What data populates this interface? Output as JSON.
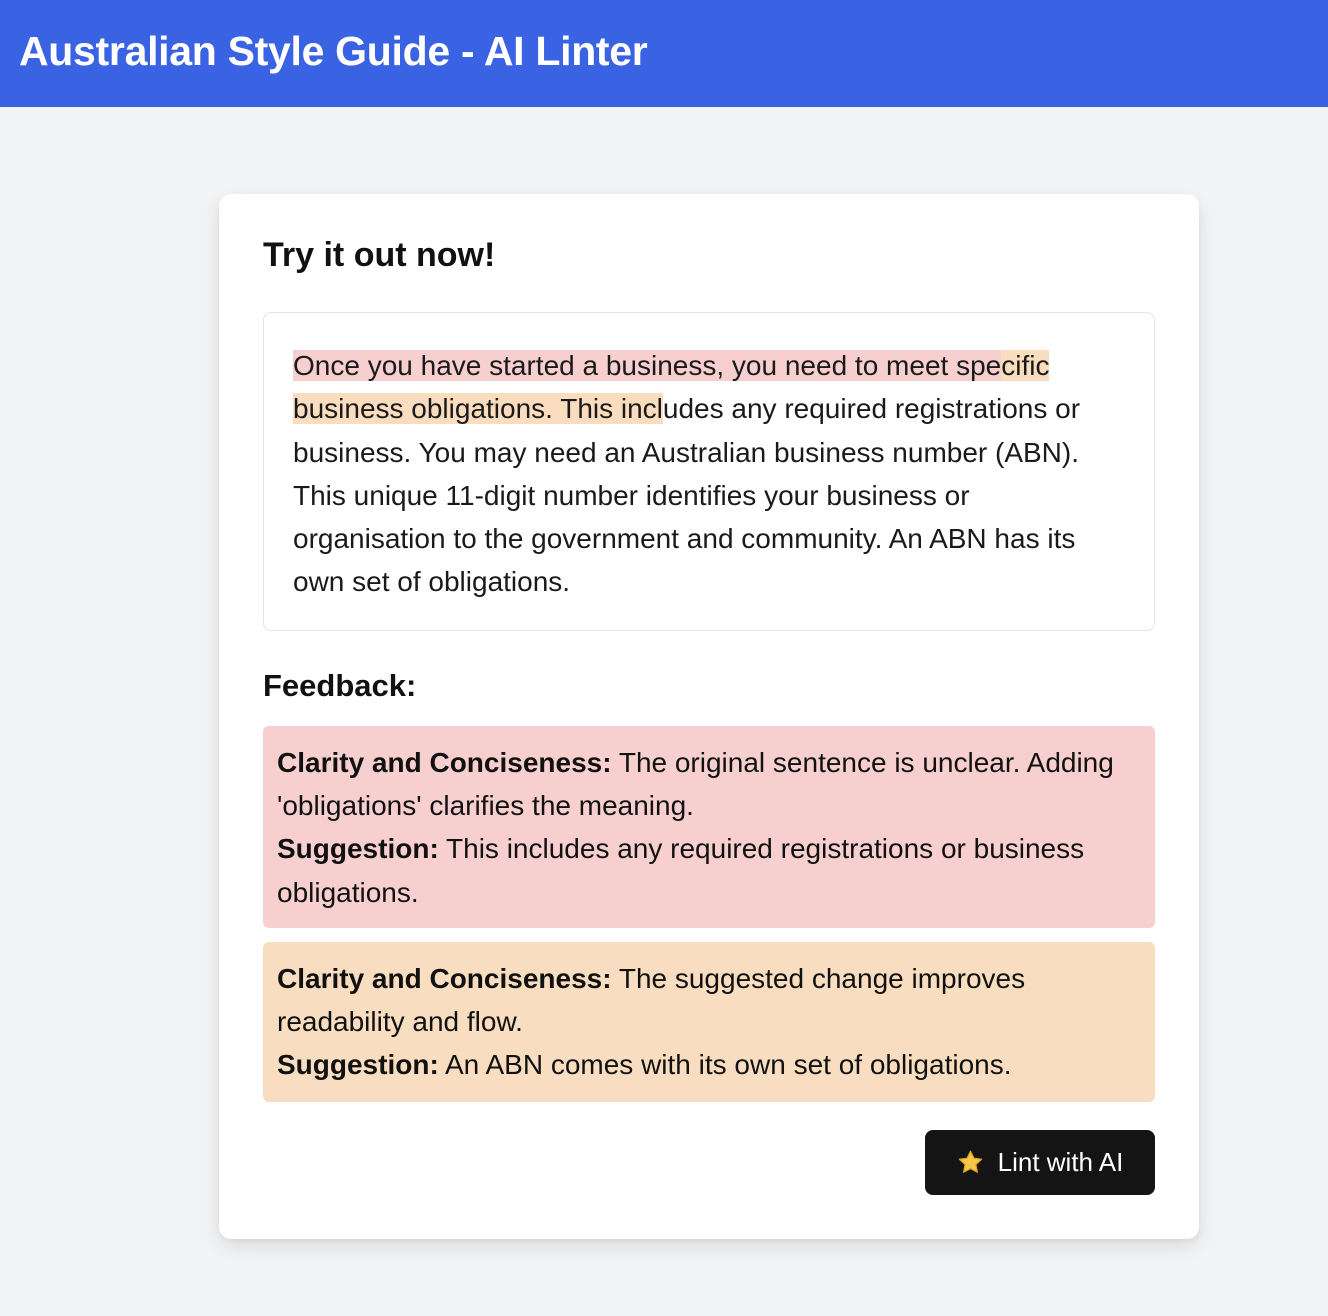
{
  "header": {
    "title": "Australian Style Guide - AI Linter",
    "background": "#3a63e4"
  },
  "card": {
    "title": "Try it out now!"
  },
  "editor": {
    "segments": {
      "red": "Once you have started a business, you need to meet spe",
      "both": "cific",
      "orange": "business obligations. This incl",
      "plain_1": "udes any required registrations or business. You may need an Australian business number (ABN). This unique 11-digit number identifies your business or organisation to the government and community. An ABN has its own set of obligations."
    }
  },
  "feedback": {
    "title": "Feedback:",
    "items": [
      {
        "category": "Clarity and Conciseness:",
        "text": " The original sentence is unclear. Adding 'obligations' clarifies the meaning.",
        "suggestion_label": "Suggestion:",
        "suggestion": " This includes any required registrations or business obligations.",
        "color": "#f8cfcf"
      },
      {
        "category": "Clarity and Conciseness:",
        "text": " The suggested change improves readability and flow.",
        "suggestion_label": "Suggestion:",
        "suggestion": " An ABN comes with its own set of obligations.",
        "color": "#f9ddc0"
      }
    ]
  },
  "button": {
    "label": "Lint with AI",
    "icon": "star-icon"
  }
}
